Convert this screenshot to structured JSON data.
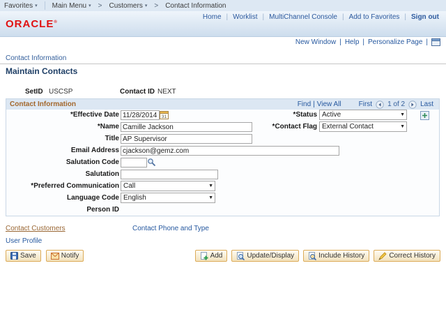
{
  "ui": {
    "pipe": "|",
    "gt": ">",
    "caret": "▾",
    "select_arrow": "▼"
  },
  "breadcrumb": {
    "favorites": "Favorites",
    "main_menu": "Main Menu",
    "customers": "Customers",
    "current": "Contact Information"
  },
  "header": {
    "logo": "ORACLE",
    "links": [
      "Home",
      "Worklist",
      "MultiChannel Console",
      "Add to Favorites"
    ],
    "sign_out": "Sign out"
  },
  "pagebar": {
    "new_window": "New Window",
    "help": "Help",
    "personalize": "Personalize Page"
  },
  "page": {
    "tab": "Contact Information",
    "title": "Maintain Contacts"
  },
  "keys": {
    "setid_label": "SetID",
    "setid_value": "USCSP",
    "contact_id_label": "Contact ID",
    "contact_id_value": "NEXT"
  },
  "section": {
    "title": "Contact Information",
    "find": "Find",
    "view_all": "View All",
    "first": "First",
    "position": "1 of 2",
    "last": "Last"
  },
  "fields": {
    "effective_date": {
      "label": "*Effective Date",
      "value": "11/28/2014"
    },
    "status": {
      "label": "*Status",
      "value": "Active"
    },
    "name": {
      "label": "*Name",
      "value": "Camille Jackson"
    },
    "contact_flag": {
      "label": "*Contact Flag",
      "value": "External Contact"
    },
    "title": {
      "label": "Title",
      "value": "AP Supervisor"
    },
    "email": {
      "label": "Email Address",
      "value": "cjackson@gemz.com"
    },
    "salutation_code": {
      "label": "Salutation Code",
      "value": ""
    },
    "salutation": {
      "label": "Salutation",
      "value": ""
    },
    "preferred_communication": {
      "label": "*Preferred Communication",
      "value": "Call"
    },
    "language_code": {
      "label": "Language Code",
      "value": "English"
    },
    "person_id": {
      "label": "Person ID",
      "value": ""
    }
  },
  "links": {
    "contact_customers": "Contact Customers",
    "contact_phone": "Contact Phone and Type",
    "user_profile": "User Profile"
  },
  "toolbar": {
    "save": "Save",
    "notify": "Notify",
    "add": "Add",
    "update_display": "Update/Display",
    "include_history": "Include History",
    "correct_history": "Correct History"
  },
  "colors": {
    "link_blue": "#26589f",
    "oracle_red": "#e01212",
    "section_title_brown": "#a3672c",
    "bar_blue": "#dde8f3",
    "button_border": "#dcab57"
  }
}
